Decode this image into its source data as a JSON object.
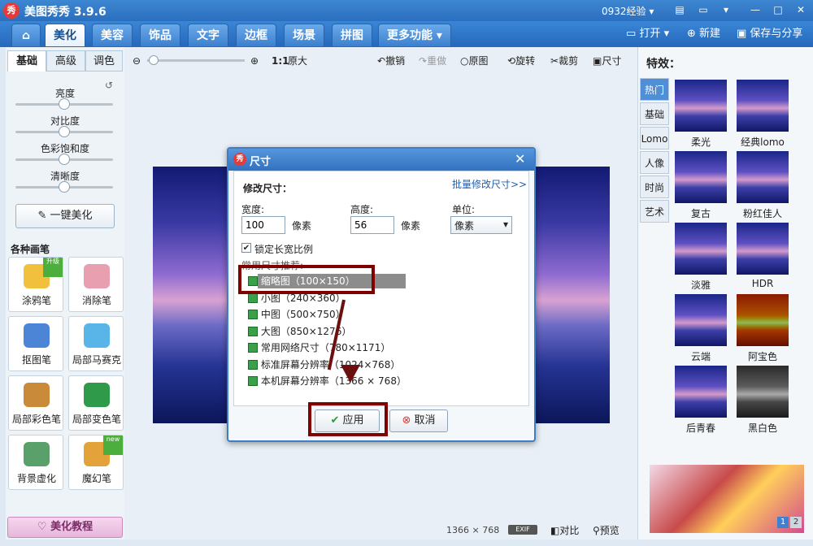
{
  "app": {
    "logo_text": "秀",
    "title": "美图秀秀 3.9.6",
    "account": "0932经验 ▾"
  },
  "nav": {
    "home_label": "⌂",
    "tabs": [
      "美化",
      "美容",
      "饰品",
      "文字",
      "边框",
      "场景",
      "拼图",
      "更多功能 ▾"
    ],
    "open": "打开",
    "new": "新建",
    "save": "保存与分享"
  },
  "left": {
    "tabs": [
      "基础",
      "高级",
      "调色"
    ],
    "sliders": [
      {
        "label": "亮度",
        "value": 0.5
      },
      {
        "label": "对比度",
        "value": 0.5
      },
      {
        "label": "色彩饱和度",
        "value": 0.5
      },
      {
        "label": "清晰度",
        "value": 0.5
      }
    ],
    "one_click": "一键美化",
    "brushes_title": "各种画笔",
    "tools": [
      {
        "label": "涂鸦笔",
        "badge": "升级"
      },
      {
        "label": "消除笔",
        "badge": ""
      },
      {
        "label": "抠图笔",
        "badge": ""
      },
      {
        "label": "局部马赛克",
        "badge": ""
      },
      {
        "label": "局部彩色笔",
        "badge": ""
      },
      {
        "label": "局部变色笔",
        "badge": ""
      },
      {
        "label": "背景虚化",
        "badge": ""
      },
      {
        "label": "魔幻笔",
        "badge": "new"
      }
    ],
    "tutorial": "美化教程"
  },
  "toolbar": {
    "ratio": "1:1",
    "original_size": "原大",
    "undo": "撤销",
    "redo": "重做",
    "original": "原图",
    "rotate": "旋转",
    "crop": "裁剪",
    "size": "尺寸"
  },
  "dialog": {
    "logo": "秀",
    "title": "尺寸",
    "section": "修改尺寸：",
    "batch_link": "批量修改尺寸>>",
    "width_label": "宽度:",
    "width_value": "100",
    "width_unit": "像素",
    "height_label": "高度:",
    "height_value": "56",
    "height_unit": "像素",
    "unit_label": "单位:",
    "unit_value": "像素",
    "lock_ratio": "锁定长宽比例",
    "presets_title": "常用尺寸推荐:",
    "presets": [
      "缩略图（100×150）",
      "小图（240×360）",
      "中图（500×750）",
      "大图（850×1276）",
      "常用网络尺寸（780×1171）",
      "标准屏幕分辨率（1024×768）",
      "本机屏幕分辨率（1366 × 768）"
    ],
    "apply": "应用",
    "cancel": "取消"
  },
  "right": {
    "title": "特效：",
    "tabs": [
      "热门",
      "基础",
      "Lomo",
      "人像",
      "时尚",
      "艺术"
    ],
    "effects": [
      "柔光",
      "经典lomo",
      "复古",
      "粉红佳人",
      "淡雅",
      "HDR",
      "云端",
      "阿宝色",
      "后青春",
      "黑白色"
    ],
    "pages": [
      "1",
      "2"
    ]
  },
  "status": {
    "resolution": "1366 × 768",
    "exif": "EXIF",
    "compare": "对比",
    "preview": "预览"
  }
}
